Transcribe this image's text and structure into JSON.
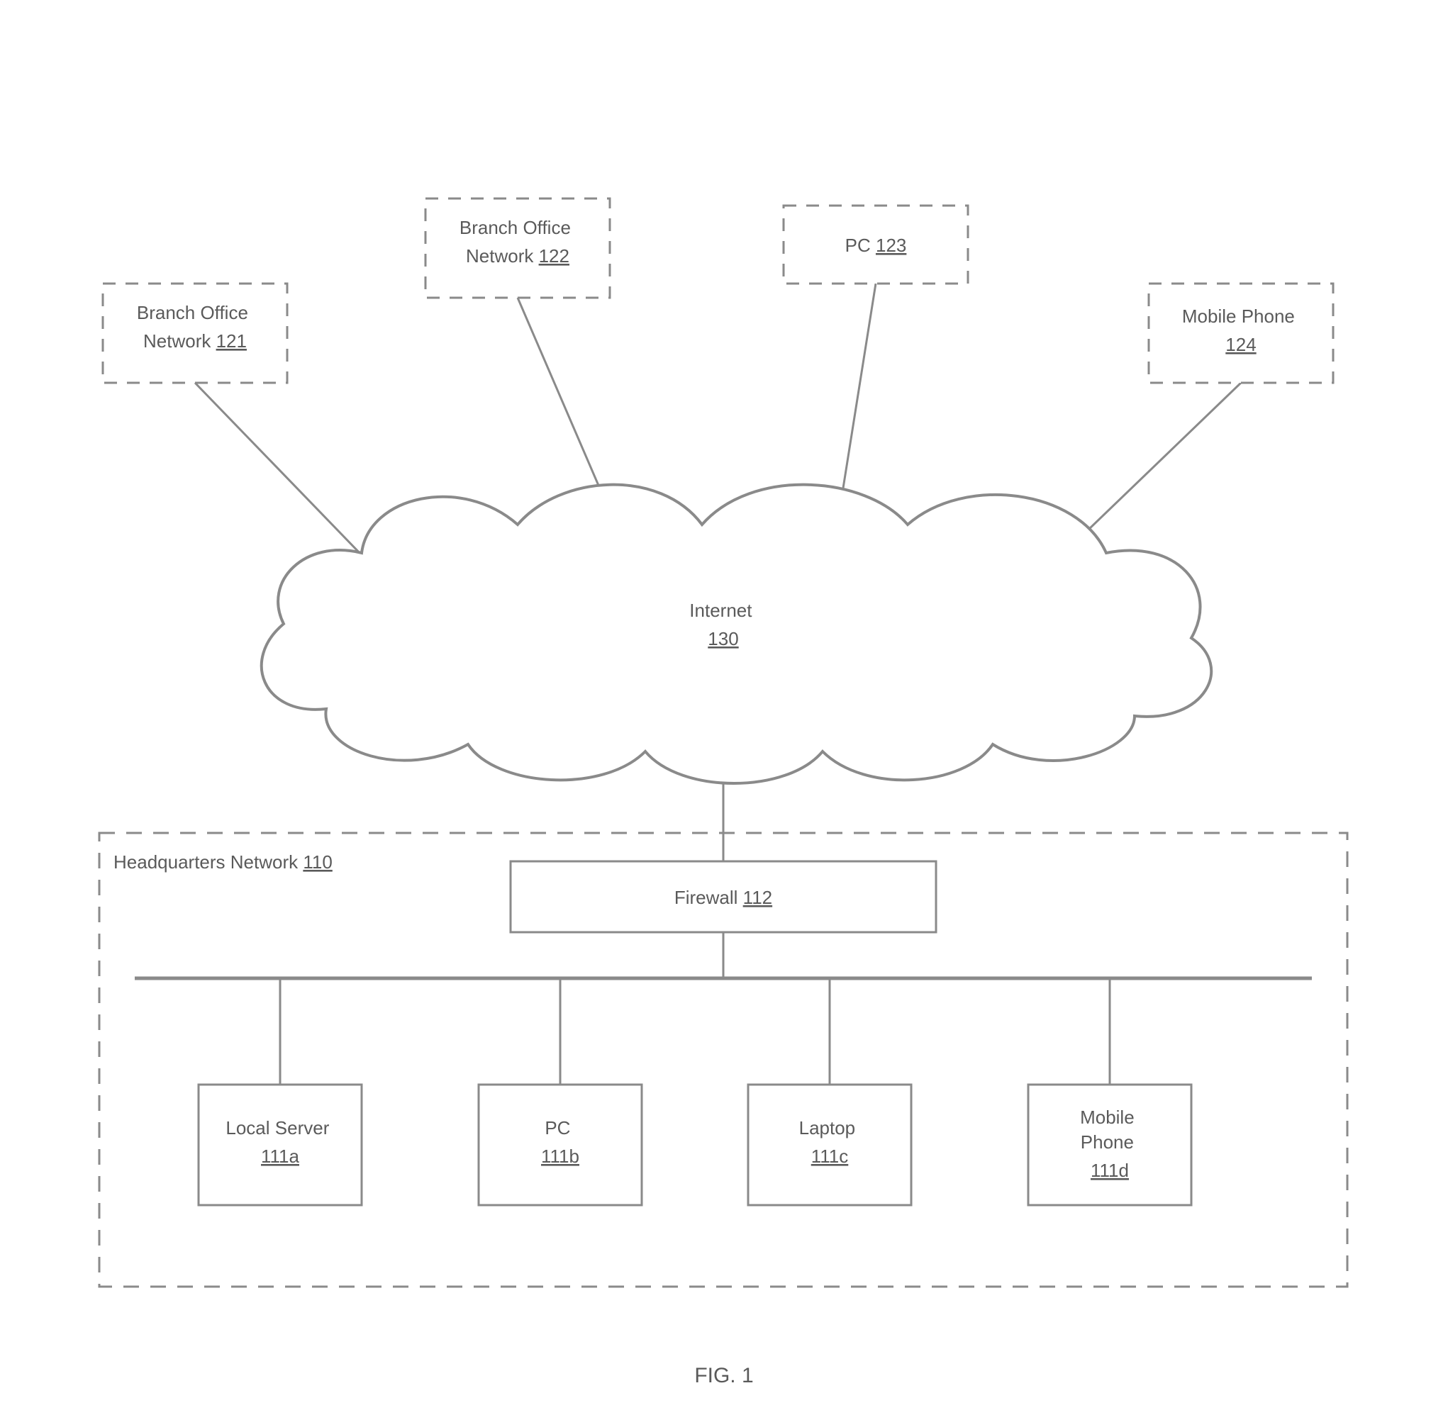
{
  "figure_label": "FIG. 1",
  "cloud": {
    "label": "Internet",
    "ref": "130"
  },
  "external_nodes": {
    "branch1": {
      "label": "Branch Office Network",
      "ref": "121"
    },
    "branch2": {
      "label": "Branch Office Network",
      "ref": "122"
    },
    "pc": {
      "label": "PC",
      "ref": "123"
    },
    "mobile": {
      "label": "Mobile Phone",
      "ref": "124"
    }
  },
  "hq": {
    "label": "Headquarters Network",
    "ref": "110",
    "firewall": {
      "label": "Firewall",
      "ref": "112"
    },
    "devices": {
      "local_server": {
        "label": "Local Server",
        "ref": "111a"
      },
      "pc": {
        "label": "PC",
        "ref": "111b"
      },
      "laptop": {
        "label": "Laptop",
        "ref": "111c"
      },
      "mobile": {
        "label": "Mobile Phone",
        "ref": "111d"
      }
    }
  }
}
